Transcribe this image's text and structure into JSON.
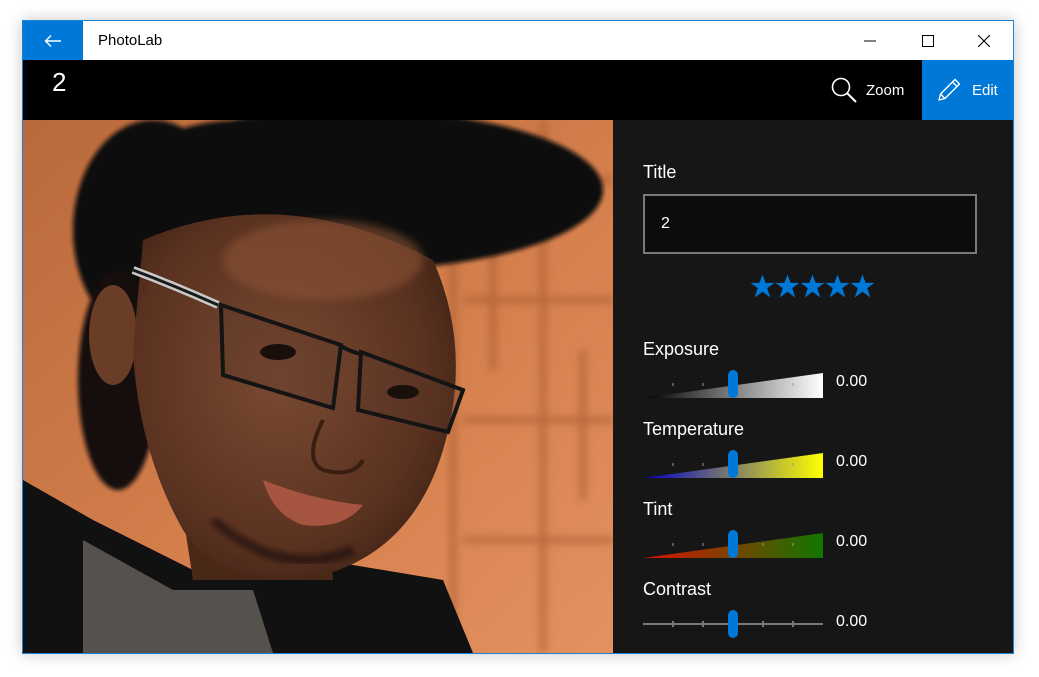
{
  "window": {
    "app_title": "PhotoLab",
    "accent_color": "#0078d7",
    "back_icon": "back-arrow-icon",
    "controls": [
      "minimize-icon",
      "maximize-icon",
      "close-icon"
    ]
  },
  "command_bar": {
    "page_title": "2",
    "zoom_label": "Zoom",
    "zoom_icon": "magnifier-icon",
    "edit_label": "Edit",
    "edit_icon": "pencil-icon"
  },
  "photo": {
    "description_icon": "portrait-photo"
  },
  "edit_panel": {
    "title_label": "Title",
    "title_value": "2",
    "rating": 5,
    "rating_max": 5,
    "sliders": [
      {
        "label": "Exposure",
        "value": "0.00",
        "position": 0.5,
        "color_from": "#000000",
        "color_to": "#ffffff"
      },
      {
        "label": "Temperature",
        "value": "0.00",
        "position": 0.5,
        "color_from": "#0000cc",
        "color_to": "#ffff00"
      },
      {
        "label": "Tint",
        "value": "0.00",
        "position": 0.5,
        "color_from": "#dd1100",
        "color_to": "#117700"
      },
      {
        "label": "Contrast",
        "value": "0.00",
        "position": 0.5
      }
    ]
  }
}
